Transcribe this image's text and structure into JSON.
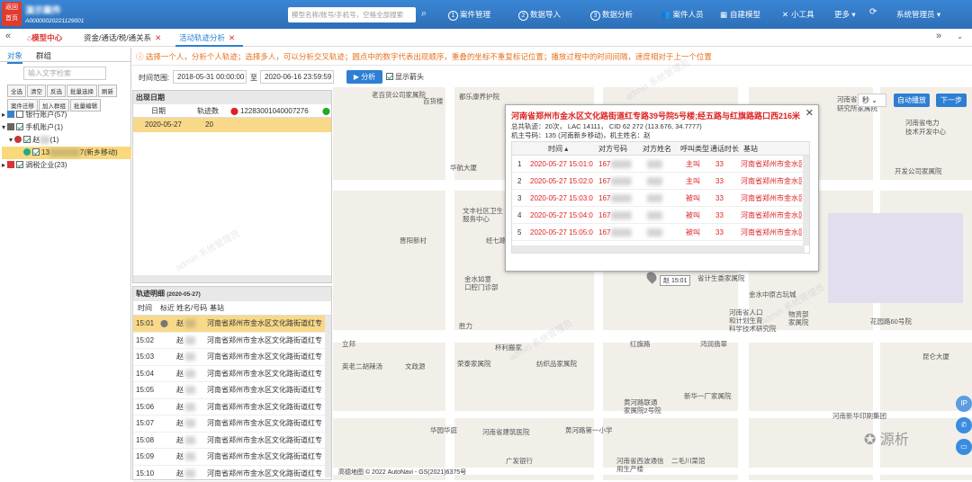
{
  "topbar": {
    "back_label_1": "返回",
    "back_label_2": "首页",
    "user_name": "演示案件",
    "case_code": "A000000202211290​01",
    "search_placeholder": "模型名称/账号/手机号，空格全部搜索",
    "nav": [
      {
        "icon": "1",
        "label": "案件管理"
      },
      {
        "icon": "2",
        "label": "数据导入"
      },
      {
        "icon": "3",
        "label": "数据分析"
      },
      {
        "icon": "user-icon",
        "label": "案件人员"
      },
      {
        "icon": "model-icon",
        "label": "自建模型"
      },
      {
        "icon": "tool-icon",
        "label": "小工具"
      },
      {
        "icon": "",
        "label": "更多"
      },
      {
        "icon": "refresh-icon",
        "label": ""
      },
      {
        "icon": "",
        "label": "系统管理员"
      }
    ]
  },
  "tabs": {
    "home": "模型中心",
    "tab1": "资金/通话/税/通关系",
    "tab2": "活动轨迹分析"
  },
  "left": {
    "tab_object": "对象",
    "tab_group": "群组",
    "search_placeholder": "输入文字检索",
    "buttons": [
      "全选",
      "清空",
      "反选",
      "批量选择",
      "刷新",
      "案件迁移",
      "加入群组",
      "批量编辑"
    ],
    "tree": [
      {
        "label": "银行账户(57)",
        "level": 0
      },
      {
        "label": "手机账户(1)",
        "level": 0
      },
      {
        "label": "赵",
        "suffix": "(1)",
        "level": 1
      },
      {
        "label": "13",
        "suffix": "7(新乡移动)",
        "level": 2
      },
      {
        "label": "调税企业(23)",
        "level": 0
      }
    ]
  },
  "hint": "选择一个人，分析个人轨迹；选择多人，可以分析交叉轨迹；圆点中的数字代表出现顺序，重叠的坐标不重复标记位置；播放过程中的时间间隔，速度相对于上一个位置",
  "timebar": {
    "label": "时间范围:",
    "start": "2018-05-31 00:00:00",
    "to": "至",
    "end": "2020-06-16 23:59:59",
    "analyze": "分析",
    "show_arrow": "显示箭头"
  },
  "occurrence": {
    "title": "出现日期",
    "col_date": "日期",
    "col_count": "轨迹数",
    "col_number": "12283001040007276",
    "rows": [
      {
        "date": "2020-05-27",
        "count": "20"
      }
    ]
  },
  "detail": {
    "title": "轨迹明细",
    "title_date": "(2020-05-27)",
    "cols": [
      "时间",
      "标近",
      "姓名/号码",
      "基站"
    ],
    "rows": [
      {
        "time": "15:01",
        "name": "赵",
        "site": "河南省郑州市金水区文化路街道红专"
      },
      {
        "time": "15:02",
        "name": "赵",
        "site": "河南省郑州市金水区文化路街道红专"
      },
      {
        "time": "15:03",
        "name": "赵",
        "site": "河南省郑州市金水区文化路街道红专"
      },
      {
        "time": "15:04",
        "name": "赵",
        "site": "河南省郑州市金水区文化路街道红专"
      },
      {
        "time": "15:05",
        "name": "赵",
        "site": "河南省郑州市金水区文化路街道红专"
      },
      {
        "time": "15:06",
        "name": "赵",
        "site": "河南省郑州市金水区文化路街道红专"
      },
      {
        "time": "15:07",
        "name": "赵",
        "site": "河南省郑州市金水区文化路街道红专"
      },
      {
        "time": "15:08",
        "name": "赵",
        "site": "河南省郑州市金水区文化路街道红专"
      },
      {
        "time": "15:09",
        "name": "赵",
        "site": "河南省郑州市金水区文化路街道红专"
      },
      {
        "time": "15:10",
        "name": "赵",
        "site": "河南省郑州市金水区文化路街道红专"
      }
    ]
  },
  "popup": {
    "title": "河南省郑州市金水区文化路街道红专路39号院5号楼;经五路与红旗路路口西216米",
    "info1": "总共轨迹：20次， LAC 14111， CID 62        272 (113.676, 34.7777)",
    "info2": "机主号码：135             (河南新乡移动)，机主姓名：赵",
    "cols": [
      "时间",
      "对方号码",
      "对方姓名",
      "呼叫类型",
      "通话时长",
      "基站"
    ],
    "rows": [
      {
        "n": "1",
        "time": "2020-05-27 15:01:0",
        "num": "167",
        "type": "主叫",
        "dur": "33",
        "site": "河南省郑州市金水区"
      },
      {
        "n": "2",
        "time": "2020-05-27 15:02:0",
        "num": "167",
        "type": "主叫",
        "dur": "33",
        "site": "河南省郑州市金水区"
      },
      {
        "n": "3",
        "time": "2020-05-27 15:03:0",
        "num": "167",
        "type": "被叫",
        "dur": "33",
        "site": "河南省郑州市金水区"
      },
      {
        "n": "4",
        "time": "2020-05-27 15:04:0",
        "num": "167",
        "type": "被叫",
        "dur": "33",
        "site": "河南省郑州市金水区"
      },
      {
        "n": "5",
        "time": "2020-05-27 15:05:0",
        "num": "167",
        "type": "被叫",
        "dur": "33",
        "site": "河南省郑州市金水区"
      }
    ]
  },
  "map": {
    "unit": "秒",
    "autoplay": "自动播放",
    "next": "下一步",
    "marker": "赵    15:01",
    "labels": [
      "老百货公司家属院",
      "百货楼",
      "都乐康养护院",
      "河南省化学",
      "研究所家属院",
      "河南省电力",
      "技术开发中心",
      "华航大厦",
      "文丰社区卫生",
      "服务中心",
      "晋阳新村",
      "金水如意",
      "口腔门诊部",
      "经七路",
      "省计生委家属院",
      "金水中原古玩城",
      "开发公司家属院",
      "胜力",
      "河南省人口",
      "和计划生育",
      "科学技术研究院",
      "物资部",
      "家属院",
      "花园路60号院",
      "红旗路",
      "立邦",
      "杯利搬家",
      "鸿润翡翠",
      "英老二胡辣汤",
      "文政源",
      "荣泰家属院",
      "纺织品家属院",
      "新华一厂家属院",
      "黄河路联通",
      "家属院2号院",
      "华园华庭",
      "河南省建筑医院",
      "黄河路第一小学",
      "广发银行",
      "河南省西波通信",
      "用生产楼",
      "河南新华印刷集团",
      "二毛川菜馆",
      "昆仑大厦"
    ],
    "footer": "高德地图   © 2022 AutoNavi - GS(2021)6375号",
    "watermark": "admin 系统管理员",
    "brand_watermark": "源析"
  },
  "colors": {
    "primary": "#2d7fd3",
    "danger": "#d22222",
    "highlight": "#f8d98a",
    "hint": "#e6721f"
  }
}
